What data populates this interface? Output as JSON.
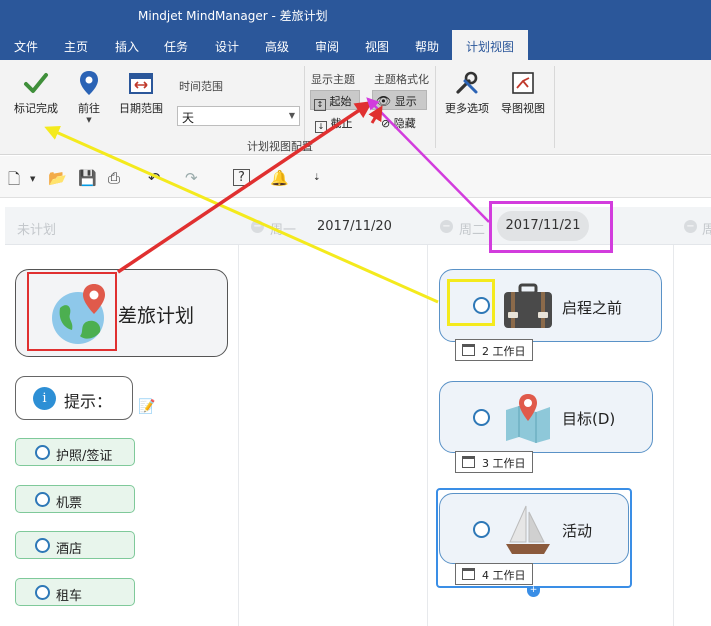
{
  "window": {
    "title": "Mindjet MindManager - 差旅计划"
  },
  "ribbon_tabs": [
    "文件",
    "主页",
    "插入",
    "任务",
    "设计",
    "高级",
    "审阅",
    "视图",
    "帮助",
    "计划视图"
  ],
  "ribbon": {
    "mark_complete": "标记完成",
    "go_to": "前往",
    "date_range": "日期范围",
    "time_range_label": "时间范围",
    "time_range_value": "天",
    "show_topics_label": "显示主题",
    "start": "起始",
    "truncate": "截止",
    "topic_format_label": "主题格式化",
    "show": "显示",
    "hide": "隐藏",
    "more_options": "更多选项",
    "map_view": "导图视图",
    "group_label": "计划视图配置"
  },
  "plan_view": {
    "col_unplanned": "未计划",
    "col1_day": "周一",
    "col1_date": "2017/11/20",
    "col2_day": "周二",
    "col2_date": "2017/11/21",
    "col3_day": "周"
  },
  "left_column": {
    "main_topic": "差旅计划",
    "hint": "提示：",
    "info_glyph": "i",
    "items": [
      "护照/签证",
      "机票",
      "酒店",
      "租车"
    ]
  },
  "tasks": [
    {
      "label": "启程之前",
      "duration": "2 工作日"
    },
    {
      "label": "目标(D)",
      "duration": "3 工作日"
    },
    {
      "label": "活动",
      "duration": "4 工作日"
    }
  ],
  "colors": {
    "ribbon_blue": "#2b579a",
    "annotation_red": "#e03030",
    "annotation_yellow": "#f4ea1d",
    "annotation_magenta": "#d23cdd",
    "task_border": "#5a92c7",
    "chip_green": "#7fc99a"
  },
  "icons": [
    "checkmark-icon",
    "location-pin-icon",
    "date-range-icon",
    "start-icon",
    "truncate-icon",
    "eye-icon",
    "hide-icon",
    "tools-icon",
    "map-view-icon",
    "new-icon",
    "open-icon",
    "save-icon",
    "print-icon",
    "undo-icon",
    "redo-icon",
    "help-icon",
    "bell-icon",
    "globe-pin-icon",
    "briefcase-icon",
    "map-icon",
    "sailboat-icon",
    "calendar-icon",
    "note-icon"
  ]
}
